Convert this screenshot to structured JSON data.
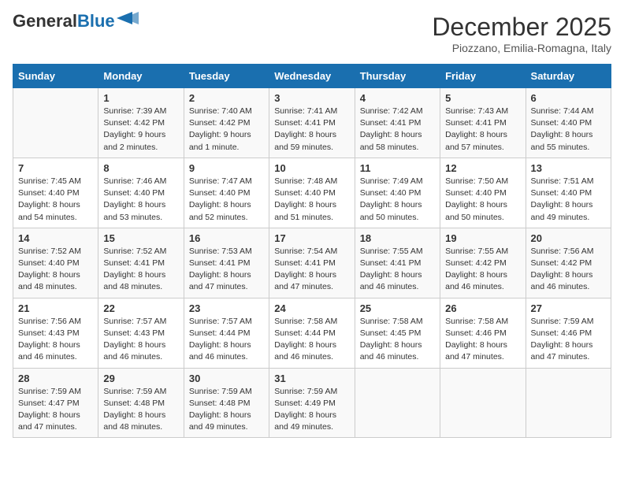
{
  "header": {
    "logo_line1": "General",
    "logo_line2": "Blue",
    "month": "December 2025",
    "location": "Piozzano, Emilia-Romagna, Italy"
  },
  "days_of_week": [
    "Sunday",
    "Monday",
    "Tuesday",
    "Wednesday",
    "Thursday",
    "Friday",
    "Saturday"
  ],
  "weeks": [
    [
      {
        "day": "",
        "info": ""
      },
      {
        "day": "1",
        "info": "Sunrise: 7:39 AM\nSunset: 4:42 PM\nDaylight: 9 hours\nand 2 minutes."
      },
      {
        "day": "2",
        "info": "Sunrise: 7:40 AM\nSunset: 4:42 PM\nDaylight: 9 hours\nand 1 minute."
      },
      {
        "day": "3",
        "info": "Sunrise: 7:41 AM\nSunset: 4:41 PM\nDaylight: 8 hours\nand 59 minutes."
      },
      {
        "day": "4",
        "info": "Sunrise: 7:42 AM\nSunset: 4:41 PM\nDaylight: 8 hours\nand 58 minutes."
      },
      {
        "day": "5",
        "info": "Sunrise: 7:43 AM\nSunset: 4:41 PM\nDaylight: 8 hours\nand 57 minutes."
      },
      {
        "day": "6",
        "info": "Sunrise: 7:44 AM\nSunset: 4:40 PM\nDaylight: 8 hours\nand 55 minutes."
      }
    ],
    [
      {
        "day": "7",
        "info": "Sunrise: 7:45 AM\nSunset: 4:40 PM\nDaylight: 8 hours\nand 54 minutes."
      },
      {
        "day": "8",
        "info": "Sunrise: 7:46 AM\nSunset: 4:40 PM\nDaylight: 8 hours\nand 53 minutes."
      },
      {
        "day": "9",
        "info": "Sunrise: 7:47 AM\nSunset: 4:40 PM\nDaylight: 8 hours\nand 52 minutes."
      },
      {
        "day": "10",
        "info": "Sunrise: 7:48 AM\nSunset: 4:40 PM\nDaylight: 8 hours\nand 51 minutes."
      },
      {
        "day": "11",
        "info": "Sunrise: 7:49 AM\nSunset: 4:40 PM\nDaylight: 8 hours\nand 50 minutes."
      },
      {
        "day": "12",
        "info": "Sunrise: 7:50 AM\nSunset: 4:40 PM\nDaylight: 8 hours\nand 50 minutes."
      },
      {
        "day": "13",
        "info": "Sunrise: 7:51 AM\nSunset: 4:40 PM\nDaylight: 8 hours\nand 49 minutes."
      }
    ],
    [
      {
        "day": "14",
        "info": "Sunrise: 7:52 AM\nSunset: 4:40 PM\nDaylight: 8 hours\nand 48 minutes."
      },
      {
        "day": "15",
        "info": "Sunrise: 7:52 AM\nSunset: 4:41 PM\nDaylight: 8 hours\nand 48 minutes."
      },
      {
        "day": "16",
        "info": "Sunrise: 7:53 AM\nSunset: 4:41 PM\nDaylight: 8 hours\nand 47 minutes."
      },
      {
        "day": "17",
        "info": "Sunrise: 7:54 AM\nSunset: 4:41 PM\nDaylight: 8 hours\nand 47 minutes."
      },
      {
        "day": "18",
        "info": "Sunrise: 7:55 AM\nSunset: 4:41 PM\nDaylight: 8 hours\nand 46 minutes."
      },
      {
        "day": "19",
        "info": "Sunrise: 7:55 AM\nSunset: 4:42 PM\nDaylight: 8 hours\nand 46 minutes."
      },
      {
        "day": "20",
        "info": "Sunrise: 7:56 AM\nSunset: 4:42 PM\nDaylight: 8 hours\nand 46 minutes."
      }
    ],
    [
      {
        "day": "21",
        "info": "Sunrise: 7:56 AM\nSunset: 4:43 PM\nDaylight: 8 hours\nand 46 minutes."
      },
      {
        "day": "22",
        "info": "Sunrise: 7:57 AM\nSunset: 4:43 PM\nDaylight: 8 hours\nand 46 minutes."
      },
      {
        "day": "23",
        "info": "Sunrise: 7:57 AM\nSunset: 4:44 PM\nDaylight: 8 hours\nand 46 minutes."
      },
      {
        "day": "24",
        "info": "Sunrise: 7:58 AM\nSunset: 4:44 PM\nDaylight: 8 hours\nand 46 minutes."
      },
      {
        "day": "25",
        "info": "Sunrise: 7:58 AM\nSunset: 4:45 PM\nDaylight: 8 hours\nand 46 minutes."
      },
      {
        "day": "26",
        "info": "Sunrise: 7:58 AM\nSunset: 4:46 PM\nDaylight: 8 hours\nand 47 minutes."
      },
      {
        "day": "27",
        "info": "Sunrise: 7:59 AM\nSunset: 4:46 PM\nDaylight: 8 hours\nand 47 minutes."
      }
    ],
    [
      {
        "day": "28",
        "info": "Sunrise: 7:59 AM\nSunset: 4:47 PM\nDaylight: 8 hours\nand 47 minutes."
      },
      {
        "day": "29",
        "info": "Sunrise: 7:59 AM\nSunset: 4:48 PM\nDaylight: 8 hours\nand 48 minutes."
      },
      {
        "day": "30",
        "info": "Sunrise: 7:59 AM\nSunset: 4:48 PM\nDaylight: 8 hours\nand 49 minutes."
      },
      {
        "day": "31",
        "info": "Sunrise: 7:59 AM\nSunset: 4:49 PM\nDaylight: 8 hours\nand 49 minutes."
      },
      {
        "day": "",
        "info": ""
      },
      {
        "day": "",
        "info": ""
      },
      {
        "day": "",
        "info": ""
      }
    ]
  ]
}
